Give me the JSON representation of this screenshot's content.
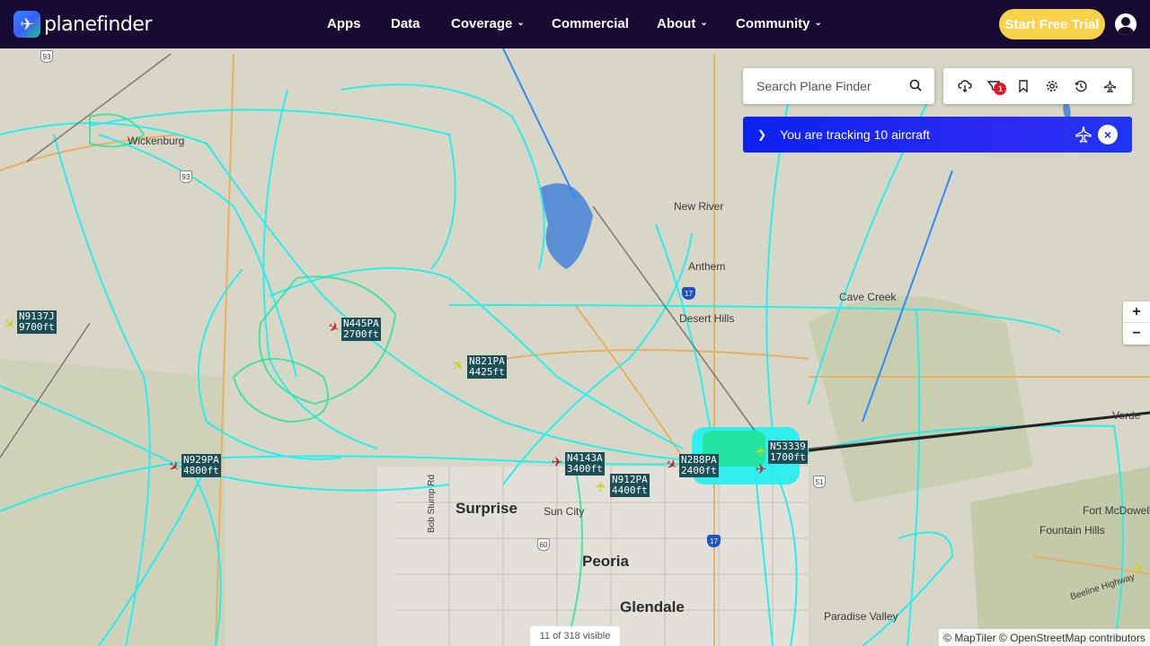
{
  "header": {
    "brand": "planefinder",
    "nav": [
      {
        "label": "Apps",
        "dropdown": false
      },
      {
        "label": "Data",
        "dropdown": false
      },
      {
        "label": "Coverage",
        "dropdown": true
      },
      {
        "label": "Commercial",
        "dropdown": false
      },
      {
        "label": "About",
        "dropdown": true
      },
      {
        "label": "Community",
        "dropdown": true
      }
    ],
    "trial_button": "Start Free Trial"
  },
  "search": {
    "placeholder": "Search Plane Finder"
  },
  "toolbar": {
    "filter_badge": "1"
  },
  "tracking_banner": {
    "text": "You are tracking 10 aircraft"
  },
  "zoom": {
    "in": "+",
    "out": "−"
  },
  "footer": {
    "visible_count": "11 of 318 visible",
    "attribution": "© MapTiler © OpenStreetMap contributors"
  },
  "map": {
    "places": [
      {
        "name": "Wickenburg",
        "size": "small"
      },
      {
        "name": "New River",
        "size": "small"
      },
      {
        "name": "Anthem",
        "size": "small"
      },
      {
        "name": "Cave Creek",
        "size": "small"
      },
      {
        "name": "Desert Hills",
        "size": "small"
      },
      {
        "name": "Surprise",
        "size": "big"
      },
      {
        "name": "Sun City",
        "size": "small"
      },
      {
        "name": "Peoria",
        "size": "big"
      },
      {
        "name": "Glendale",
        "size": "big"
      },
      {
        "name": "Paradise Valley",
        "size": "small"
      },
      {
        "name": "Fountain Hills",
        "size": "small"
      },
      {
        "name": "Fort McDowell",
        "size": "small"
      },
      {
        "name": "Verde",
        "size": "small"
      },
      {
        "name": "Bob Stump Rd",
        "size": "small"
      },
      {
        "name": "Beeline Highway",
        "size": "small"
      }
    ],
    "shields": [
      "93",
      "93",
      "17",
      "51",
      "60",
      "17"
    ],
    "aircraft": [
      {
        "reg": "N9137J",
        "alt": "9700ft",
        "color": "yellow"
      },
      {
        "reg": "N445PA",
        "alt": "2700ft",
        "color": "red"
      },
      {
        "reg": "N821PA",
        "alt": "4425ft",
        "color": "yellow"
      },
      {
        "reg": "N929PA",
        "alt": "4800ft",
        "color": "red"
      },
      {
        "reg": "N4143A",
        "alt": "3400ft",
        "color": "red"
      },
      {
        "reg": "N912PA",
        "alt": "4400ft",
        "color": "yellow"
      },
      {
        "reg": "N288PA",
        "alt": "2400ft",
        "color": "red"
      },
      {
        "reg": "N53339",
        "alt": "1700ft",
        "color": "yellow"
      }
    ],
    "colors": {
      "track": "#1ff0f0",
      "track_alt": "#22e39a",
      "lake": "#5a8fd6",
      "nav": "#170b34",
      "banner": "#1a28f0",
      "trial": "#f7d24a"
    }
  }
}
